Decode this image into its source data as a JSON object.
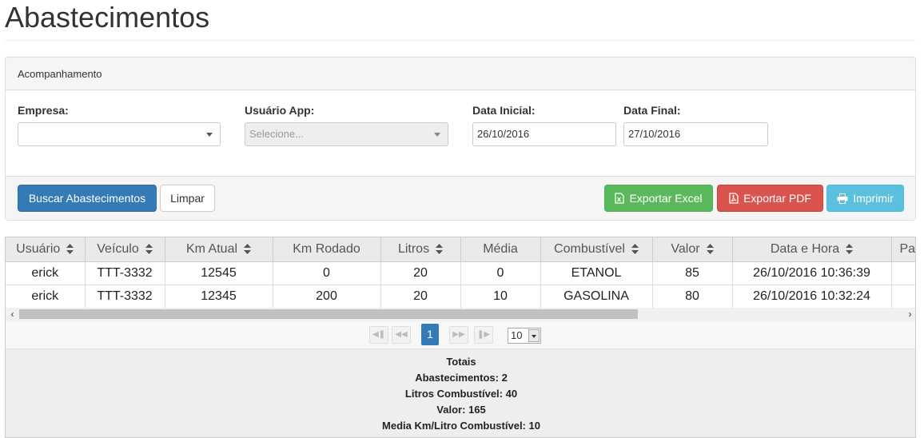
{
  "page": {
    "title": "Abastecimentos"
  },
  "panel": {
    "heading": "Acompanhamento",
    "filters": {
      "empresa": {
        "label": "Empresa:",
        "value": ""
      },
      "usuario_app": {
        "label": "Usuário App:",
        "placeholder": "Selecione..."
      },
      "data_inicial": {
        "label": "Data Inicial:",
        "value": "26/10/2016"
      },
      "data_final": {
        "label": "Data Final:",
        "value": "27/10/2016"
      }
    },
    "buttons": {
      "buscar": "Buscar Abastecimentos",
      "limpar": "Limpar",
      "exportar_excel": "Exportar Excel",
      "exportar_pdf": "Exportar PDF",
      "imprimir": "Imprimir"
    }
  },
  "table": {
    "columns": [
      "Usuário",
      "Veículo",
      "Km Atual",
      "Km Rodado",
      "Litros",
      "Média",
      "Combustível",
      "Valor",
      "Data e Hora",
      "Pa"
    ],
    "rows": [
      [
        "erick",
        "TTT-3332",
        "12545",
        "0",
        "20",
        "0",
        "ETANOL",
        "85",
        "26/10/2016 10:36:39",
        ""
      ],
      [
        "erick",
        "TTT-3332",
        "12345",
        "200",
        "20",
        "10",
        "GASOLINA",
        "80",
        "26/10/2016 10:32:24",
        ""
      ]
    ]
  },
  "pager": {
    "current_page": "1",
    "page_size": "10"
  },
  "totals": {
    "title": "Totais",
    "abastecimentos": "Abastecimentos: 2",
    "litros": "Litros Combustível: 40",
    "valor": "Valor: 165",
    "media": "Media Km/Litro Combustível: 10"
  },
  "colors": {
    "primary": "#337ab7",
    "success": "#5cb85c",
    "danger": "#d9534f",
    "info": "#5bc0de"
  }
}
